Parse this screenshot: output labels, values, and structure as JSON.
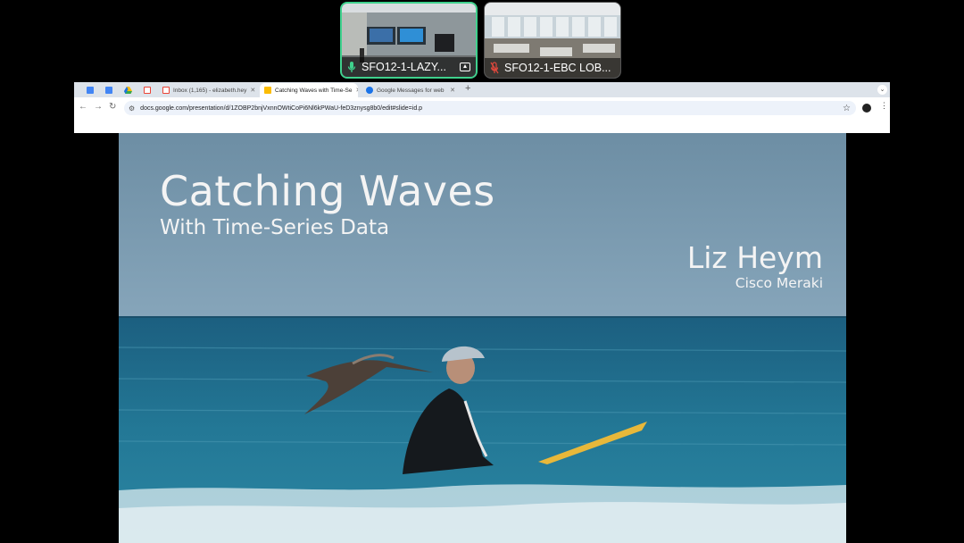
{
  "meeting": {
    "tiles": [
      {
        "name": "SFO12-1-LAZY...",
        "mic": "mic-on",
        "active": true,
        "accent": "#3fd18d"
      },
      {
        "name": "SFO12-1-EBC LOB...",
        "mic": "mic-muted",
        "active": false,
        "accent": "#e2483d"
      }
    ]
  },
  "browser": {
    "tabs": [
      {
        "label": "Inbox (1,165) - elizabeth.hey",
        "icon": "gmail-icon"
      },
      {
        "label": "Catching Waves with Time-Se",
        "icon": "slides-icon",
        "active": true
      },
      {
        "label": "Google Messages for web",
        "icon": "messages-icon"
      }
    ],
    "new_tab": "+",
    "url": "docs.google.com/presentation/d/1ZOBP2bnjVxnnOWtiCoPi6Nl6kPWaU-feD3znysg8b0/edit#slide=id.p"
  },
  "slide": {
    "title": "Catching Waves",
    "subtitle": "With Time-Series Data",
    "author": "Liz Heym",
    "organization": "Cisco Meraki"
  },
  "colors": {
    "sky": "#6f90a6",
    "ocean": "#1f6f8f",
    "board": "#e8b83a"
  }
}
